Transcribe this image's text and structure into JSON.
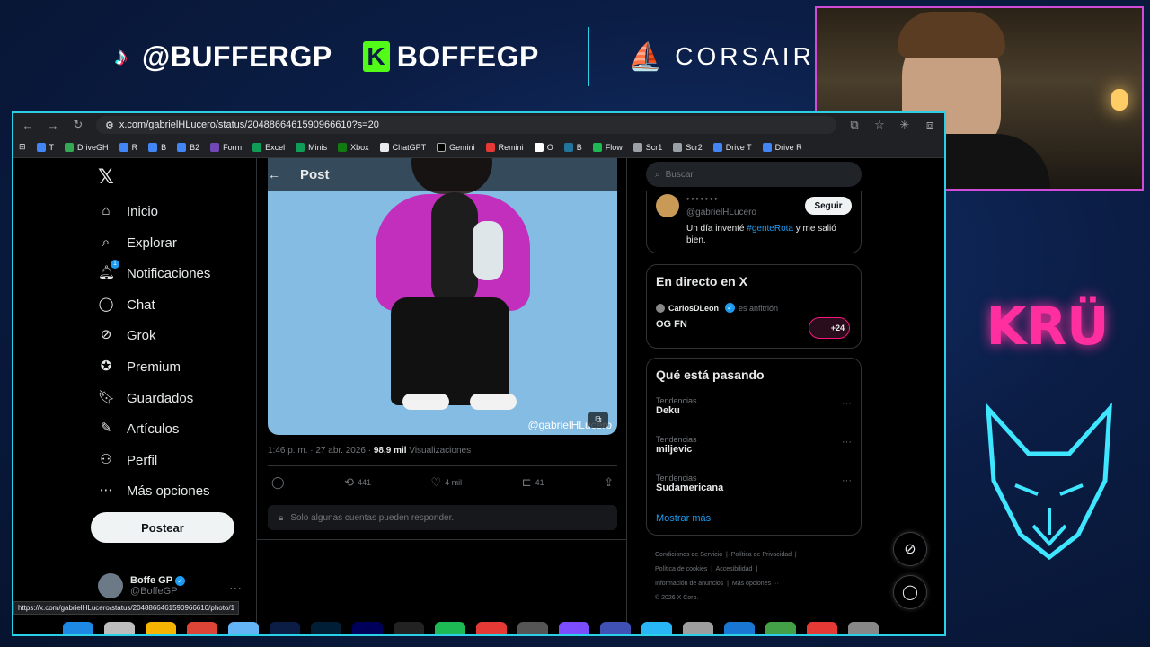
{
  "overlay": {
    "tiktok_handle": "@BUFFERGP",
    "kick_handle": "BOFFEGP",
    "sponsor": "CORSAIR",
    "team_logo": "KRÜ"
  },
  "browser": {
    "url": "x.com/gabrielHLucero/status/2048866461590966610?s=20",
    "bookmarks": [
      "T",
      "DriveGH",
      "R",
      "B",
      "B2",
      "Form",
      "Excel",
      "Minis",
      "Xbox",
      "ChatGPT",
      "Gemini",
      "Remini",
      "O",
      "B",
      "Flow",
      "Scr1",
      "Scr2",
      "Drive T",
      "Drive R"
    ],
    "status_url": "https://x.com/gabrielHLucero/status/2048866461590966610/photo/1"
  },
  "nav": {
    "items": [
      {
        "label": "Inicio",
        "icon": "home-icon"
      },
      {
        "label": "Explorar",
        "icon": "search-icon"
      },
      {
        "label": "Notificaciones",
        "icon": "bell-icon",
        "badge": "1"
      },
      {
        "label": "Chat",
        "icon": "chat-icon"
      },
      {
        "label": "Grok",
        "icon": "grok-icon"
      },
      {
        "label": "Premium",
        "icon": "premium-icon"
      },
      {
        "label": "Guardados",
        "icon": "bookmark-icon"
      },
      {
        "label": "Artículos",
        "icon": "article-icon"
      },
      {
        "label": "Perfil",
        "icon": "person-icon"
      },
      {
        "label": "Más opciones",
        "icon": "more-circle-icon"
      }
    ],
    "post_button": "Postear",
    "profile_name": "Boffe GP",
    "profile_handle": "@BoffeGP"
  },
  "post": {
    "header_title": "Post",
    "watermark": "@gabrielHLucero",
    "time": "1:46 p. m. · 27 abr. 2026 ·",
    "views_count": "98,9 mil",
    "views_label": "Visualizaciones",
    "retweets": "441",
    "likes": "4 mil",
    "bookmarks": "41",
    "reply_restriction": "Solo algunas cuentas pueden responder."
  },
  "sidebar": {
    "search_placeholder": "Buscar",
    "author": {
      "handle": "@gabrielHLucero",
      "follow_label": "Seguir",
      "bio_prefix": "Un día inventé",
      "bio_hashtag": "#genteRota",
      "bio_suffix": "y me salió bien."
    },
    "live": {
      "title": "En directo en X",
      "host": "CarlosDLeon",
      "host_suffix": "es anfitrión",
      "space_title": "OG FN",
      "listeners": "+24"
    },
    "trends": {
      "title": "Qué está pasando",
      "items": [
        {
          "category": "Tendencias",
          "name": "Deku"
        },
        {
          "category": "Tendencias",
          "name": "miljevic"
        },
        {
          "category": "Tendencias",
          "name": "Sudamericana"
        }
      ],
      "show_more": "Mostrar más"
    },
    "footer": {
      "terms": "Condiciones de Servicio",
      "privacy": "Política de Privacidad",
      "cookies": "Política de cookies",
      "accessibility": "Accesibilidad",
      "ads": "Información de anuncios",
      "more": "Más opciones ···",
      "copyright": "© 2026 X Corp."
    }
  }
}
